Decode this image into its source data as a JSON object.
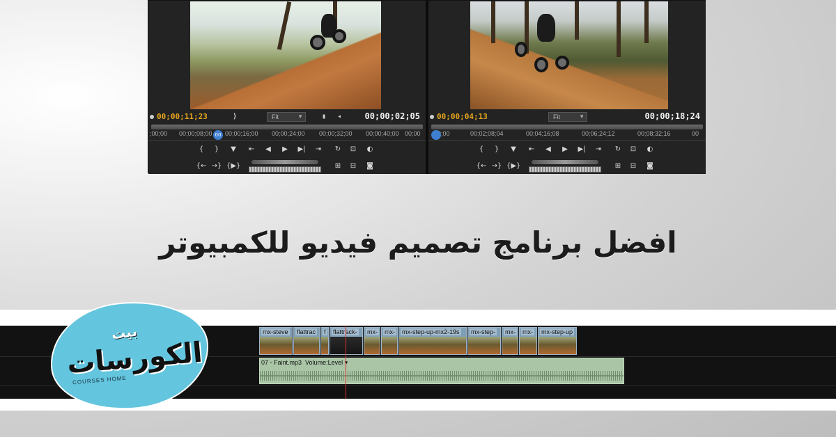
{
  "monitors": {
    "source": {
      "current_timecode": "00;00;11;23",
      "fit_label": "Fit",
      "total_timecode": "00;00;02;05",
      "ruler_ticks": [
        ";00;00",
        "00;00;08;00",
        "00;00;16;00",
        "00;00;24;00",
        "00;00;32;00",
        "00;00;40;00",
        "00;00"
      ],
      "playhead_label": "00"
    },
    "program": {
      "current_timecode": "00;00;04;13",
      "fit_label": "Fit",
      "total_timecode": "00;00;18;24",
      "ruler_ticks": [
        "00;00",
        "00;02;08;04",
        "00;04;16;08",
        "00;06;24;12",
        "00;08;32;16",
        "00"
      ],
      "playhead_label": ""
    }
  },
  "headline": "افضل برنامج تصميم فيديو للكمبيوتر",
  "timeline": {
    "video_clips": [
      "mx-steve",
      "flattrac",
      "f",
      "flattrack-",
      "mx-",
      "mx-",
      "mx-step-up-mx2-19s",
      "mx-step-",
      "mx-",
      "mx-",
      "mx-step-up"
    ],
    "audio_clip_label": "07 - Faint.mp3",
    "audio_volume_label": "Volume:Level ▾"
  },
  "logo": {
    "top_text": "بيت",
    "main_text": "الكورسات",
    "english_text": "COURSES HOME"
  },
  "colors": {
    "timecode_accent": "#e7a71d",
    "logo_blue": "#63c5de",
    "timeline_playhead": "#e0302a"
  }
}
